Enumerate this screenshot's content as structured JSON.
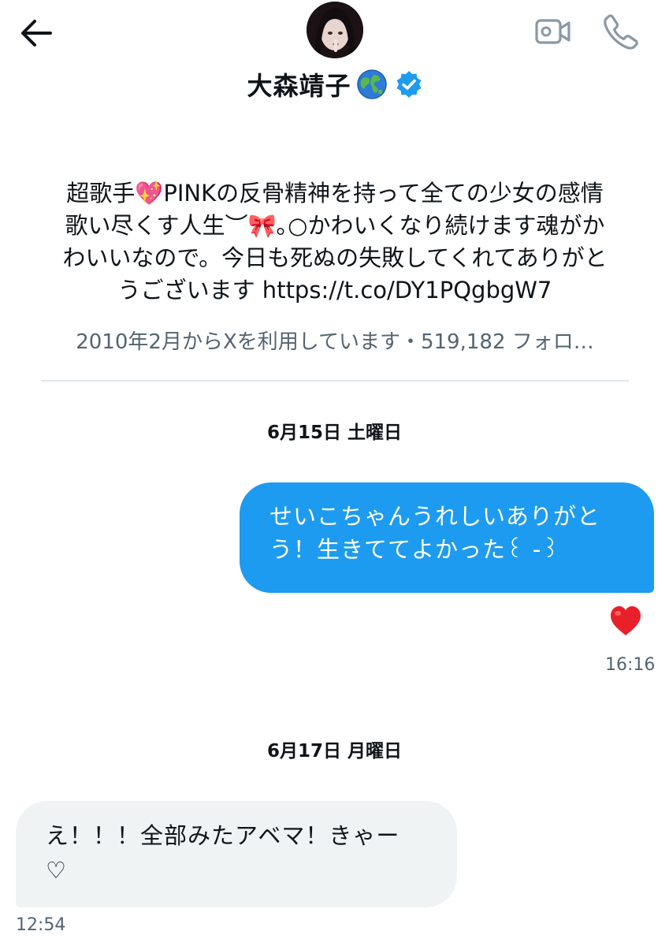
{
  "header": {
    "name": "大森靖子",
    "icons": {
      "back": "arrow-left-icon",
      "video": "video-camera-icon",
      "call": "phone-icon",
      "badge": "globe-emoji-icon",
      "verified": "verified-badge-icon"
    },
    "verified_color": "#1d9bf0"
  },
  "profile": {
    "bio_lines": [
      "超歌手💖PINKの反骨精神を持って全ての少女の感情",
      "歌い尽くす人生︶🎀｡○かわいくなり続けます魂がか",
      "わいいなので。今日も死ぬの失敗してくれてありがと",
      "うございます https://t.co/DY1PQgbgW7"
    ],
    "meta": "2010年2月からXを利用しています・519,182 フォロ…"
  },
  "messages": {
    "date1": "6月15日 土曜日",
    "sent": {
      "lines": [
        "せいこちゃんうれしいありがと",
        "う！生きててよかった꒰ -꒱"
      ],
      "reaction": "❤️",
      "time": "16:16"
    },
    "date2": "6月17日 月曜日",
    "received": {
      "lines": [
        "え！！！全部みたアベマ！きゃー",
        "♡"
      ],
      "time": "12:54"
    }
  },
  "colors": {
    "accent": "#1d9bf0",
    "received_bubble": "#eff3f4",
    "secondary_text": "#536471"
  }
}
